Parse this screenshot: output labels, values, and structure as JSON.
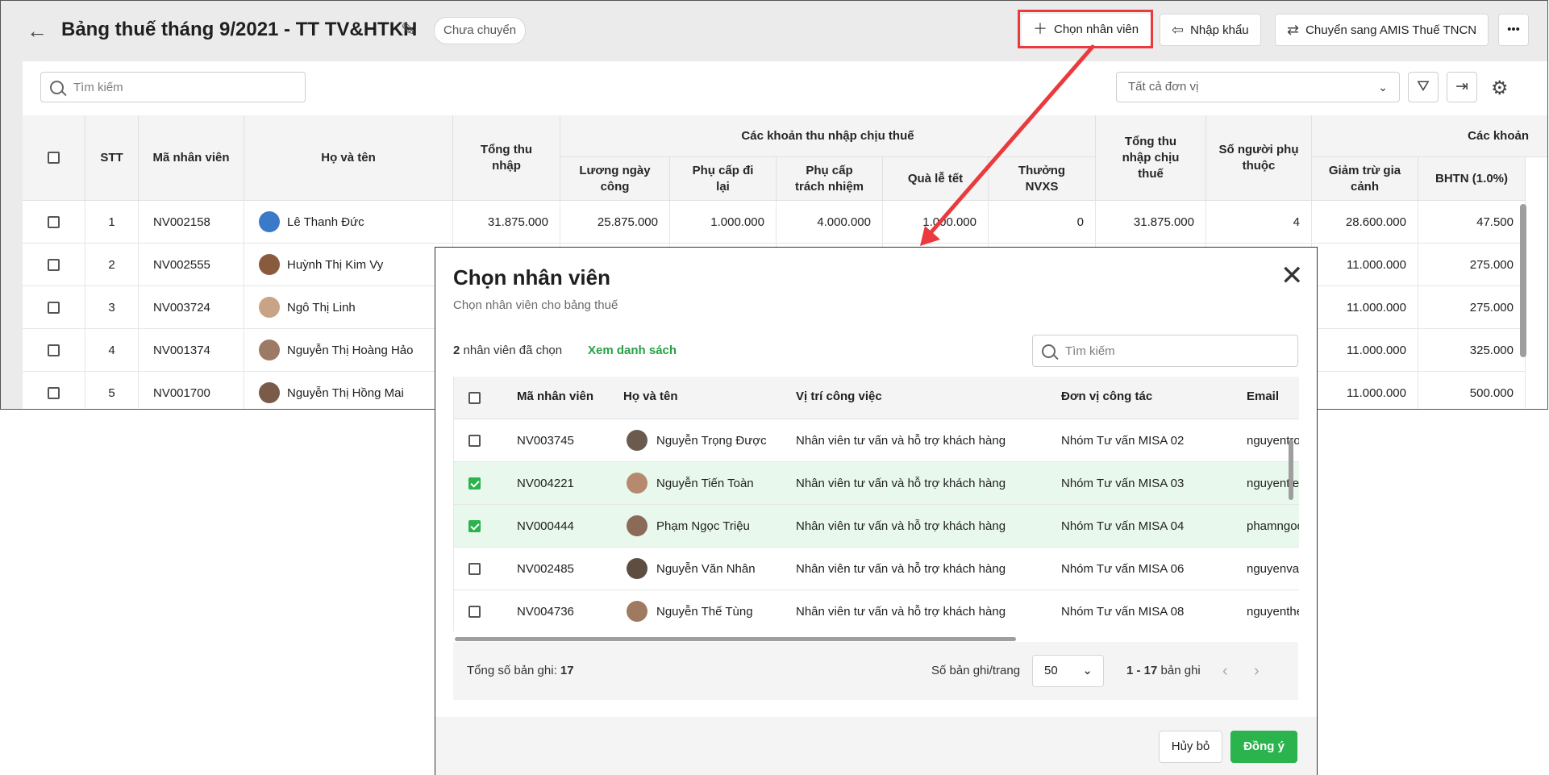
{
  "header": {
    "title": "Bảng thuế tháng 9/2021 - TT TV&HTKH",
    "status_badge": "Chưa chuyển",
    "buttons": {
      "select_employee": "Chọn nhân viên",
      "import": "Nhập khẩu",
      "transfer": "Chuyển sang AMIS Thuế TNCN"
    }
  },
  "toolbar": {
    "search_placeholder": "Tìm kiếm",
    "unit_filter": "Tất cả đơn vị"
  },
  "grid": {
    "headers": {
      "stt": "STT",
      "code": "Mã nhân viên",
      "name": "Họ và tên",
      "total_income": "Tổng thu nhập",
      "taxable_group": "Các khoản thu nhập chịu thuế",
      "salary": "Lương ngày công",
      "travel": "Phụ cấp đi lại",
      "responsibility": "Phụ cấp trách nhiệm",
      "holiday_gift": "Quà lễ tết",
      "bonus": "Thưởng NVXS",
      "total_taxable": "Tổng thu nhập chịu thuế",
      "dependents": "Số người phụ thuộc",
      "deduction_group": "Các khoản",
      "family_deduction": "Giảm trừ gia cảnh",
      "bhtn": "BHTN (1.0%)"
    },
    "rows": [
      {
        "stt": "1",
        "code": "NV002158",
        "name": "Lê Thanh Đức",
        "total": "31.875.000",
        "salary": "25.875.000",
        "travel": "1.000.000",
        "resp": "4.000.000",
        "gift": "1.000.000",
        "bonus": "0",
        "taxable": "31.875.000",
        "dependents": "4",
        "family": "28.600.000",
        "bhtn": "47.500"
      },
      {
        "stt": "2",
        "code": "NV002555",
        "name": "Huỳnh Thị Kim Vy",
        "family": "11.000.000",
        "bhtn": "275.000"
      },
      {
        "stt": "3",
        "code": "NV003724",
        "name": "Ngô Thị Linh",
        "family": "11.000.000",
        "bhtn": "275.000"
      },
      {
        "stt": "4",
        "code": "NV001374",
        "name": "Nguyễn Thị Hoàng Hảo",
        "family": "11.000.000",
        "bhtn": "325.000"
      },
      {
        "stt": "5",
        "code": "NV001700",
        "name": "Nguyễn Thị Hồng Mai",
        "family": "11.000.000",
        "bhtn": "500.000"
      }
    ]
  },
  "dialog": {
    "title": "Chọn nhân viên",
    "subtitle": "Chọn nhân viên cho bảng thuế",
    "selected_count": "2",
    "selected_suffix": "nhân viên đã chọn",
    "view_list": "Xem danh sách",
    "search_placeholder": "Tìm kiếm",
    "headers": {
      "code": "Mã nhân viên",
      "name": "Họ và tên",
      "position": "Vị trí công việc",
      "unit": "Đơn vị công tác",
      "email": "Email"
    },
    "rows": [
      {
        "code": "NV003745",
        "name": "Nguyễn Trọng Được",
        "position": "Nhân viên tư vấn và hỗ trợ khách hàng",
        "unit": "Nhóm Tư vấn MISA 02",
        "email": "nguyentro",
        "checked": false
      },
      {
        "code": "NV004221",
        "name": "Nguyễn Tiến Toàn",
        "position": "Nhân viên tư vấn và hỗ trợ khách hàng",
        "unit": "Nhóm Tư vấn MISA 03",
        "email": "nguyentie",
        "checked": true
      },
      {
        "code": "NV000444",
        "name": "Phạm Ngọc Triệu",
        "position": "Nhân viên tư vấn và hỗ trợ khách hàng",
        "unit": "Nhóm Tư vấn MISA 04",
        "email": "phamngoc",
        "checked": true
      },
      {
        "code": "NV002485",
        "name": "Nguyễn Văn Nhân",
        "position": "Nhân viên tư vấn và hỗ trợ khách hàng",
        "unit": "Nhóm Tư vấn MISA 06",
        "email": "nguyenvar",
        "checked": false
      },
      {
        "code": "NV004736",
        "name": "Nguyễn Thế Tùng",
        "position": "Nhân viên tư vấn và hỗ trợ khách hàng",
        "unit": "Nhóm Tư vấn MISA 08",
        "email": "nguyenthe",
        "checked": false
      }
    ],
    "footer": {
      "total_label": "Tổng số bản ghi:",
      "total_value": "17",
      "page_size_label": "Số bản ghi/trang",
      "page_size": "50",
      "range_value": "1 - 17",
      "range_suffix": "bản ghi"
    },
    "cancel": "Hủy bỏ",
    "ok": "Đồng ý"
  },
  "colors": {
    "accent_green": "#2bb34d",
    "highlight_red": "#ea3a3d",
    "selected_row": "#e9f8ec"
  },
  "icons": [
    "back-arrow-icon",
    "pencil-icon",
    "plus-icon",
    "import-icon",
    "swap-icon",
    "more-icon",
    "search-icon",
    "chevron-down-icon",
    "filter-icon",
    "export-icon",
    "gear-icon",
    "close-icon",
    "chevron-left-icon",
    "chevron-right-icon"
  ]
}
